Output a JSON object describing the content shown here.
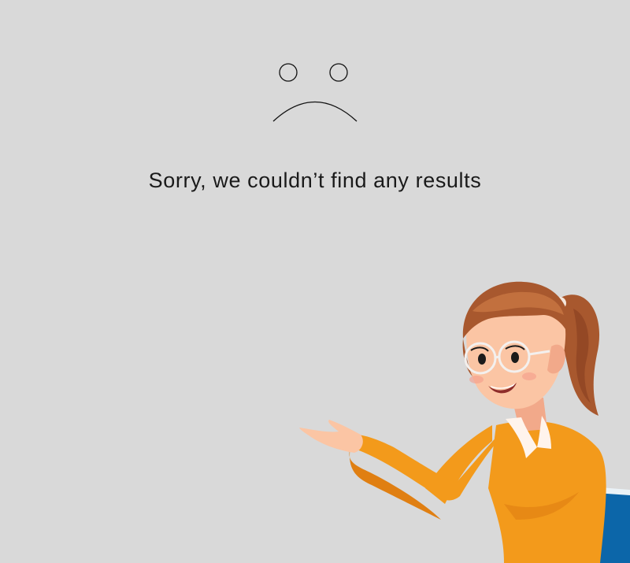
{
  "empty_state": {
    "message": "Sorry, we couldn’t find any results",
    "icon": "sad-face-icon",
    "illustration": "woman-presenting-illustration"
  },
  "colors": {
    "background": "#d9d9d9",
    "text": "#1a1a1a",
    "sweater": "#f39a1b",
    "hair": "#a8582e",
    "skin": "#fbc5a4",
    "folder": "#0c66a9"
  }
}
